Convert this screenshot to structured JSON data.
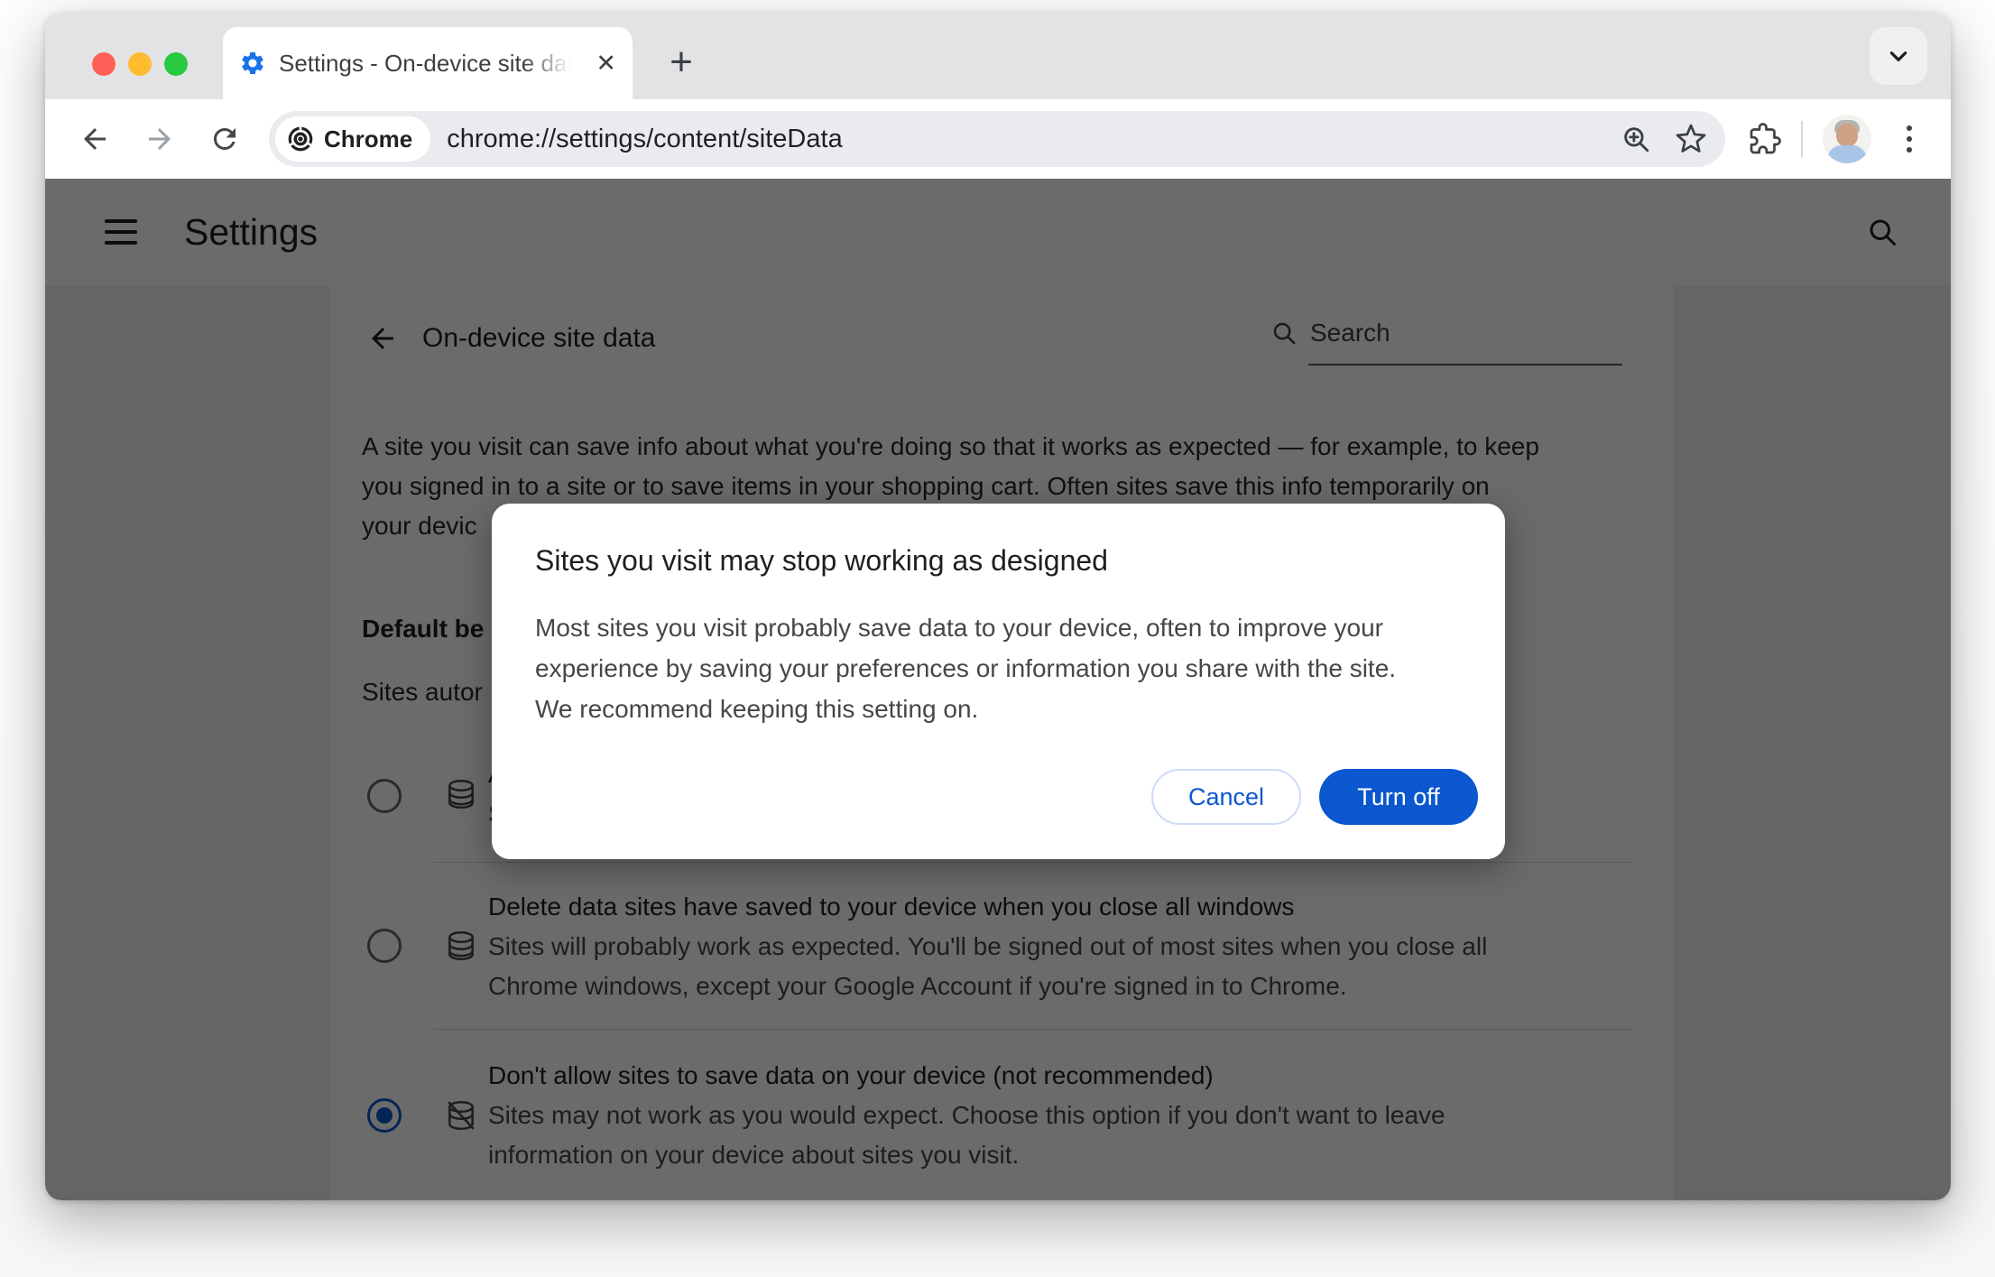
{
  "tab": {
    "title": "Settings - On-device site data",
    "close_glyph": "✕",
    "new_tab_glyph": "+"
  },
  "toolbar": {
    "chrome_badge": "Chrome",
    "url": "chrome://settings/content/siteData"
  },
  "settings_header": {
    "title": "Settings"
  },
  "page": {
    "title": "On-device site data",
    "search_placeholder": "Search",
    "intro_lines": [
      "A site you visit can save info about what you're doing so that it works as expected — for example, to keep",
      "you signed in to a site or to save items in your shopping cart. Often sites save this info temporarily on",
      "your devic"
    ],
    "section_heading_fragment": "Default be",
    "section_subline_fragment": "Sites autor",
    "options": [
      {
        "selected": false,
        "icon": "database",
        "title_fragment": "A",
        "desc_fragment": "S"
      },
      {
        "selected": false,
        "icon": "database",
        "title": "Delete data sites have saved to your device when you close all windows",
        "desc_lines": [
          "Sites will probably work as expected. You'll be signed out of most sites when you close all",
          "Chrome windows, except your Google Account if you're signed in to Chrome."
        ]
      },
      {
        "selected": true,
        "icon": "database-off",
        "title": "Don't allow sites to save data on your device (not recommended)",
        "desc_lines": [
          "Sites may not work as you would expect. Choose this option if you don't want to leave",
          "information on your device about sites you visit."
        ]
      }
    ]
  },
  "dialog": {
    "title": "Sites you visit may stop working as designed",
    "body_lines": [
      "Most sites you visit probably save data to your device, often to improve your",
      "experience by saving your preferences or information you share with the site.",
      "We recommend keeping this setting on."
    ],
    "cancel_label": "Cancel",
    "turnoff_label": "Turn off"
  },
  "colors": {
    "accent_blue": "#0b57d0",
    "favicon_blue": "#1a73e8",
    "traffic_red": "#ff5f57",
    "traffic_yellow": "#febc2e",
    "traffic_green": "#28c840",
    "scrim": "rgba(0,0,0,0.58)"
  }
}
